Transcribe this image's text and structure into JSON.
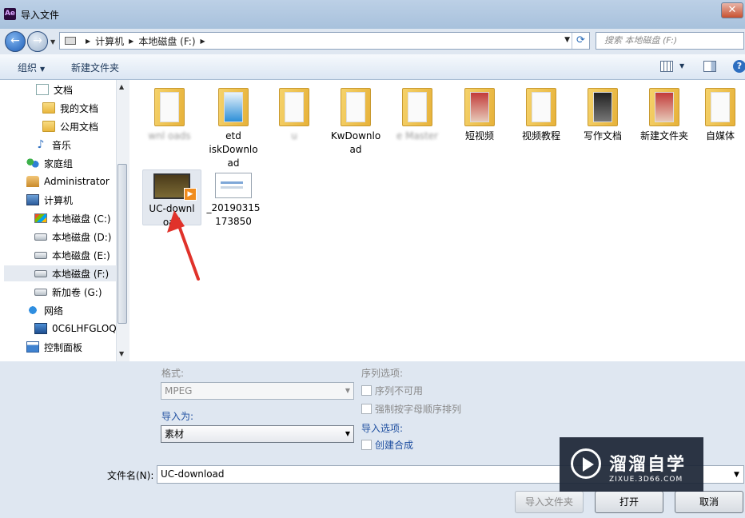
{
  "window": {
    "title": "导入文件",
    "app_icon": "Ae",
    "close_label": "✕"
  },
  "nav": {
    "crumbs": [
      "计算机",
      "本地磁盘 (F:)"
    ],
    "search_placeholder": "搜索 本地磁盘 (F:)"
  },
  "toolbar": {
    "organize": "组织",
    "new_folder": "新建文件夹",
    "help": "?"
  },
  "sidebar": {
    "items": [
      {
        "label": "文档",
        "icon": "document-icon"
      },
      {
        "label": "我的文档",
        "icon": "folder-icon"
      },
      {
        "label": "公用文档",
        "icon": "folder-icon"
      },
      {
        "label": "音乐",
        "icon": "music-icon"
      },
      {
        "label": "家庭组",
        "icon": "homegroup-icon"
      },
      {
        "label": "Administrator",
        "icon": "user-folder-icon"
      },
      {
        "label": "计算机",
        "icon": "computer-icon"
      },
      {
        "label": "本地磁盘 (C:)",
        "icon": "system-drive-icon"
      },
      {
        "label": "本地磁盘 (D:)",
        "icon": "drive-icon"
      },
      {
        "label": "本地磁盘 (E:)",
        "icon": "drive-icon"
      },
      {
        "label": "本地磁盘 (F:)",
        "icon": "drive-icon",
        "selected": true
      },
      {
        "label": "新加卷 (G:)",
        "icon": "drive-icon"
      },
      {
        "label": "网络",
        "icon": "network-icon"
      },
      {
        "label": "0C6LHFGLOQ",
        "icon": "pc-icon"
      },
      {
        "label": "控制面板",
        "icon": "control-panel-icon"
      }
    ]
  },
  "files": [
    {
      "label": "wnl oads"
    },
    {
      "label": "etd iskDownlo ad"
    },
    {
      "label": "u"
    },
    {
      "label": "KwDownlo ad"
    },
    {
      "label": "e Master"
    },
    {
      "label": "短视频"
    },
    {
      "label": "视频教程"
    },
    {
      "label": "写作文档"
    },
    {
      "label": "新建文件夹"
    },
    {
      "label": "自媒体"
    },
    {
      "label": "UC-downl oad",
      "selected": true
    },
    {
      "label": "_20190315 173850"
    }
  ],
  "options": {
    "format_label": "格式:",
    "format_value": "MPEG",
    "import_as_label": "导入为:",
    "import_as_value": "素材",
    "sequence_label": "序列选项:",
    "sequence_unavailable": "序列不可用",
    "force_alpha": "强制按字母顺序排列",
    "import_options_label": "导入选项:",
    "create_comp": "创建合成"
  },
  "filename": {
    "label": "文件名(N):",
    "value": "UC-download"
  },
  "buttons": {
    "import": "导入文件夹",
    "open": "打开",
    "cancel": "取消"
  },
  "watermark": {
    "title": "溜溜自学",
    "sub": "ZIXUE.3D66.COM"
  }
}
